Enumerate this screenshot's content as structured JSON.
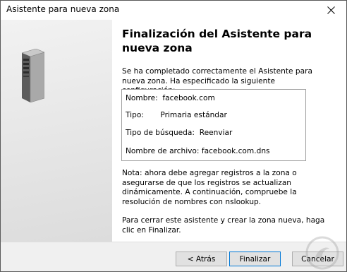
{
  "window": {
    "title": "Asistente para nueva zona"
  },
  "heading": "Finalización del Asistente para nueva zona",
  "intro": "Se ha completado correctamente el Asistente para nueva zona. Ha especificado la siguiente configuración:",
  "summary": [
    "Nombre:  facebook.com",
    "Tipo:       Primaria estándar",
    "Tipo de búsqueda:  Reenviar",
    "Nombre de archivo: facebook.com.dns"
  ],
  "note": "Nota: ahora debe agregar registros a la zona o asegurarse de que los registros se actualizan dinámicamente. A continuación, compruebe la resolución de nombres con nslookup.",
  "finish_hint": "Para cerrar este asistente y crear la zona nueva, haga clic en Finalizar.",
  "buttons": {
    "back": "< Atrás",
    "finish": "Finalizar",
    "cancel": "Cancelar"
  },
  "icons": {
    "close": "close-icon",
    "server": "server-icon",
    "watermark": "watermark-logo"
  },
  "colors": {
    "accent": "#0078d7",
    "panel": "#e8e8e8",
    "footer": "#f0f0f0"
  }
}
